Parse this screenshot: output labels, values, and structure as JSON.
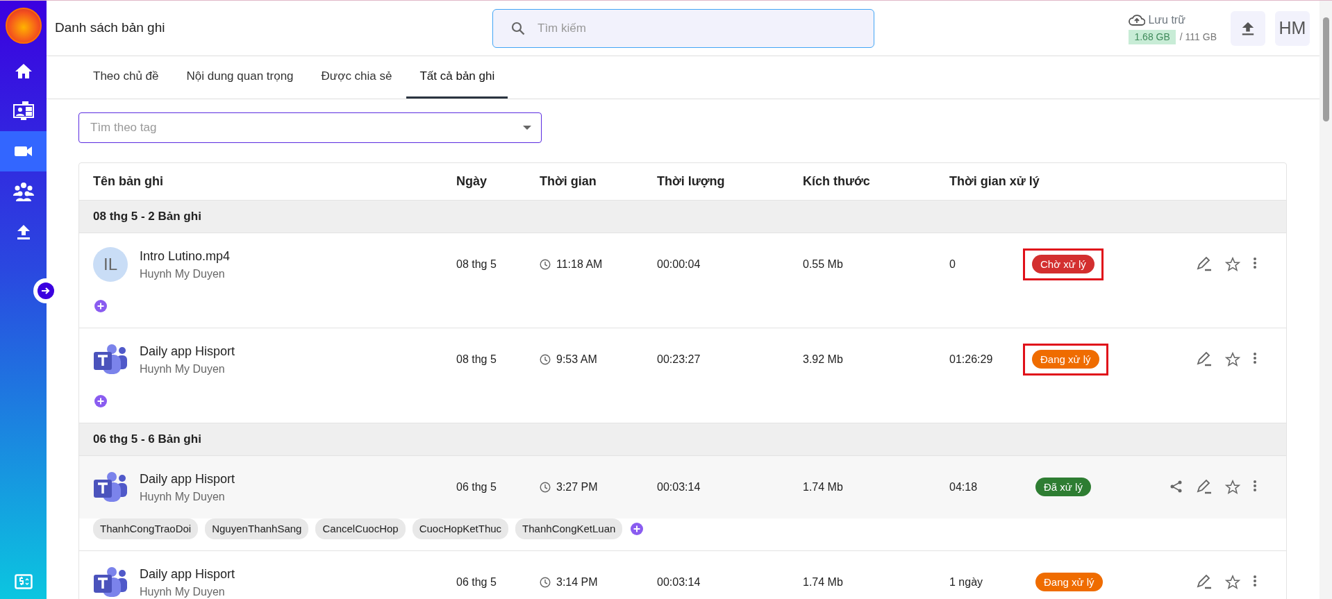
{
  "sidebar": {
    "items": [
      {
        "selected": false
      },
      {
        "selected": false
      },
      {
        "selected": true
      },
      {
        "selected": false
      },
      {
        "selected": false
      }
    ]
  },
  "header": {
    "title": "Danh sách bản ghi",
    "search": {
      "placeholder": "Tìm kiếm"
    },
    "storage": {
      "label": "Lưu trữ",
      "used": "1.68 GB",
      "total": "/ 111 GB"
    },
    "avatar": "HM"
  },
  "tabs": [
    {
      "label": "Theo chủ đề",
      "selected": false
    },
    {
      "label": "Nội dung quan trọng",
      "selected": false
    },
    {
      "label": "Được chia sẻ",
      "selected": false
    },
    {
      "label": "Tất cả bản ghi",
      "selected": true
    }
  ],
  "tag_filter": {
    "placeholder": "Tìm theo tag"
  },
  "table": {
    "columns": [
      "Tên bản ghi",
      "Ngày",
      "Thời gian",
      "Thời lượng",
      "Kích thước",
      "Thời gian xử lý"
    ],
    "groups": [
      {
        "label": "08 thg 5 - 2 Bản ghi",
        "rows": [
          {
            "kind": "avatar",
            "initials": "IL",
            "name": "Intro Lutino.mp4",
            "author": "Huynh My Duyen",
            "date": "08 thg 5",
            "time": "11:18 AM",
            "duration": "00:00:04",
            "size": "0.55 Mb",
            "processing": "0",
            "status": {
              "label": "Chờ xử lý",
              "color": "#d32f2f"
            },
            "highlighted": true,
            "hovered": false,
            "shareable": false,
            "tags": []
          },
          {
            "kind": "teams",
            "name": "Daily app Hisport",
            "author": "Huynh My Duyen",
            "date": "08 thg 5",
            "time": "9:53 AM",
            "duration": "00:23:27",
            "size": "3.92 Mb",
            "processing": "01:26:29",
            "status": {
              "label": "Đang xử lý",
              "color": "#ef6c00"
            },
            "highlighted": true,
            "hovered": false,
            "shareable": false,
            "tags": []
          }
        ]
      },
      {
        "label": "06 thg 5 - 6 Bản ghi",
        "rows": [
          {
            "kind": "teams",
            "name": "Daily app Hisport",
            "author": "Huynh My Duyen",
            "date": "06 thg 5",
            "time": "3:27 PM",
            "duration": "00:03:14",
            "size": "1.74 Mb",
            "processing": "04:18",
            "status": {
              "label": "Đã xử lý",
              "color": "#2e7d32"
            },
            "highlighted": false,
            "hovered": true,
            "shareable": true,
            "tags": [
              "ThanhCongTraoDoi",
              "NguyenThanhSang",
              "CancelCuocHop",
              "CuocHopKetThuc",
              "ThanhCongKetLuan"
            ]
          },
          {
            "kind": "teams",
            "name": "Daily app Hisport",
            "author": "Huynh My Duyen",
            "date": "06 thg 5",
            "time": "3:14 PM",
            "duration": "00:03:14",
            "size": "1.74 Mb",
            "processing": "1 ngày",
            "status": {
              "label": "Đang xử lý",
              "color": "#ef6c00"
            },
            "highlighted": false,
            "hovered": false,
            "shareable": false,
            "tags": []
          }
        ]
      }
    ]
  }
}
